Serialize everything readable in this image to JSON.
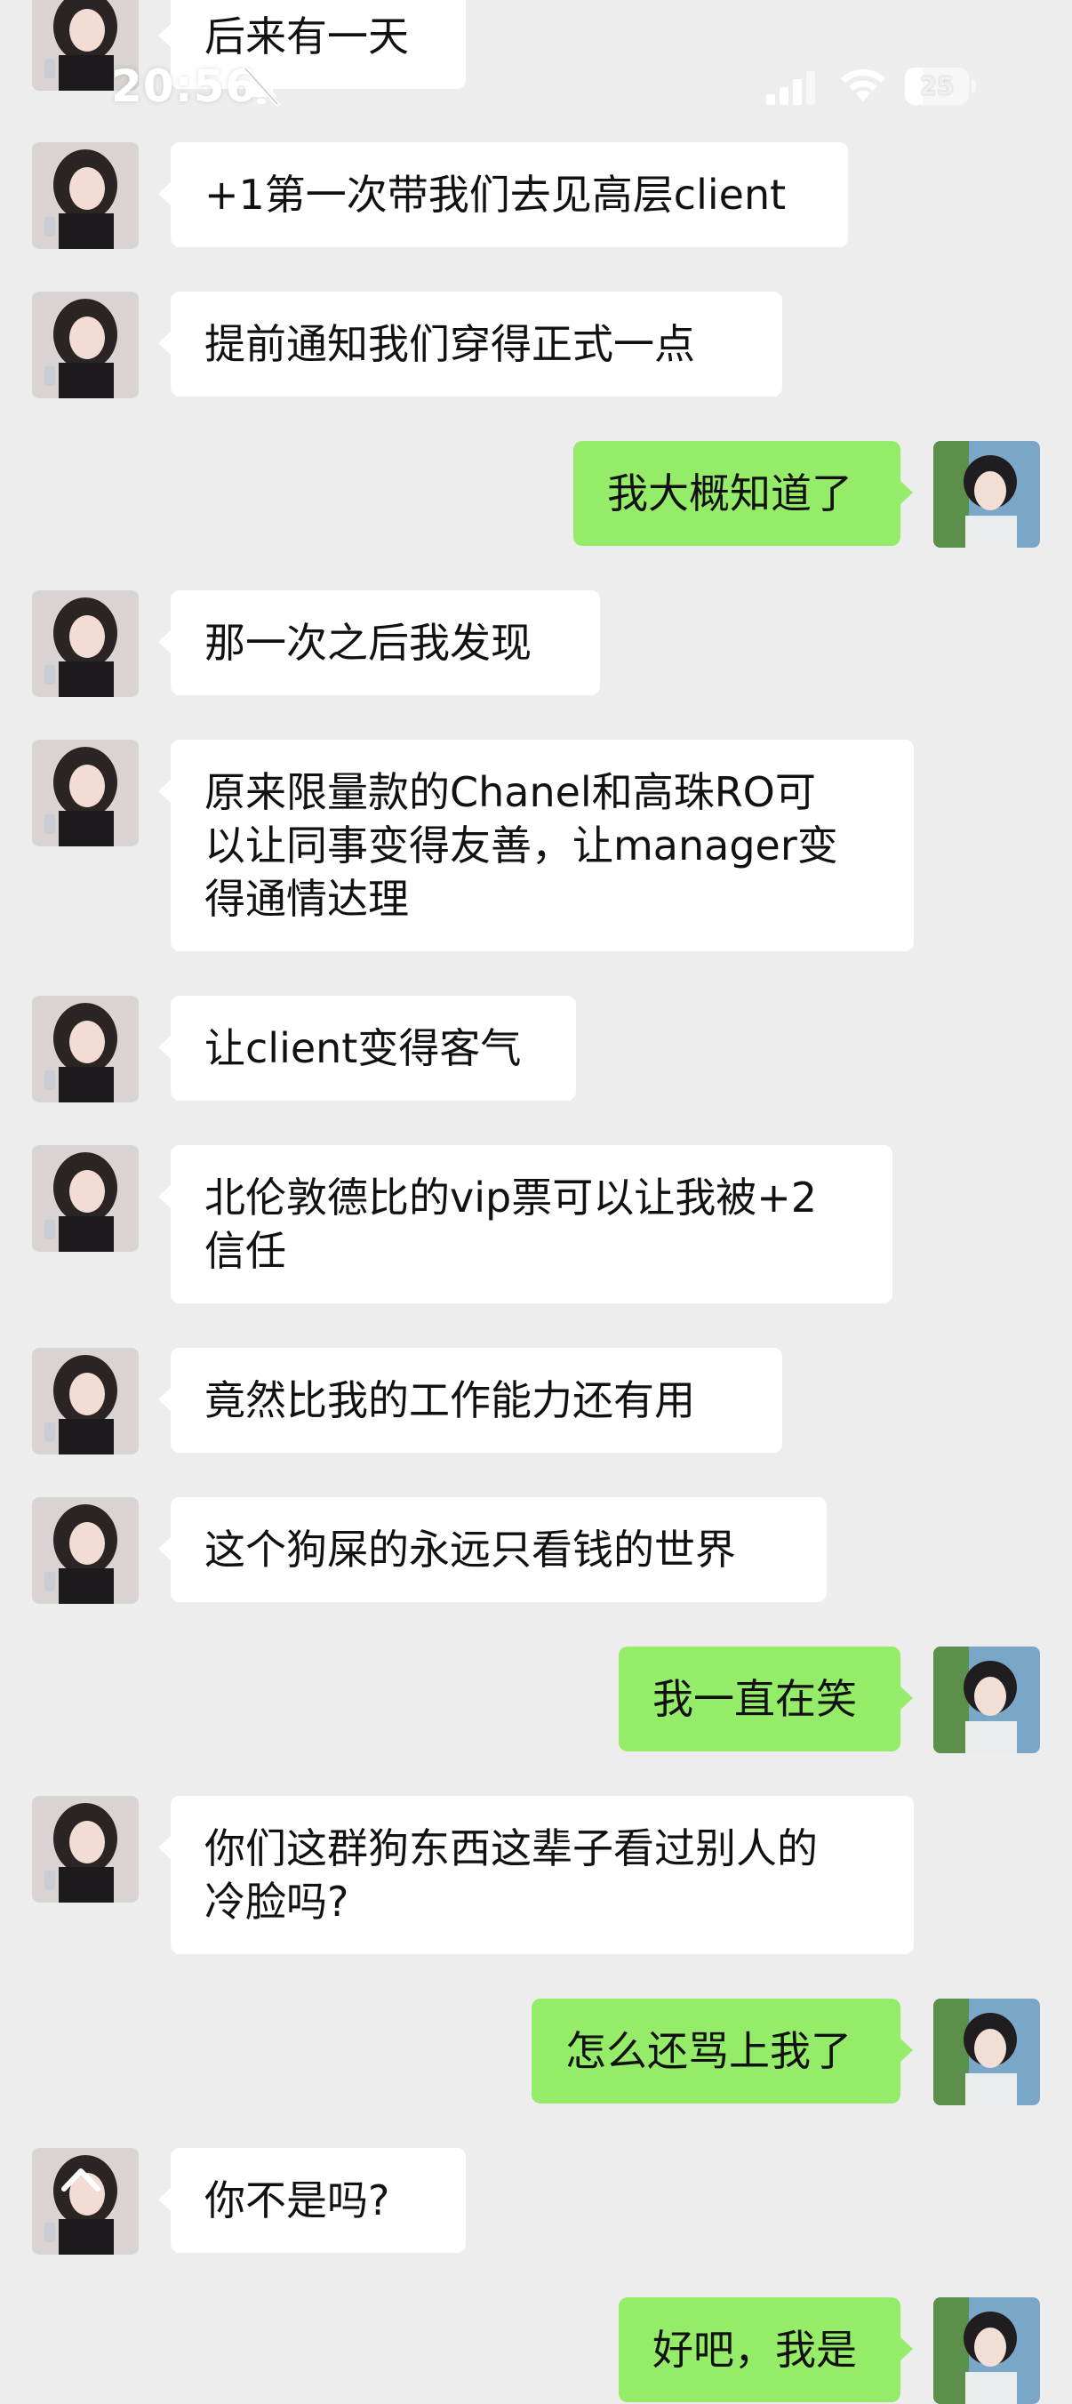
{
  "status_bar": {
    "time": "20:56",
    "battery_level": "25",
    "icons": [
      "mute-bell-icon",
      "signal-icon",
      "wifi-icon",
      "battery-icon"
    ]
  },
  "colors": {
    "background": "#ededed",
    "incoming_bubble": "#ffffff",
    "outgoing_bubble": "#95ec69",
    "text": "#111111"
  },
  "messages": [
    {
      "side": "left",
      "lines": [
        "后来有一天"
      ]
    },
    {
      "side": "left",
      "lines": [
        "+1第一次带我们去见高层client"
      ]
    },
    {
      "side": "left",
      "lines": [
        "提前通知我们穿得正式一点"
      ]
    },
    {
      "side": "right",
      "lines": [
        "我大概知道了"
      ]
    },
    {
      "side": "left",
      "lines": [
        "那一次之后我发现"
      ]
    },
    {
      "side": "left",
      "lines": [
        "原来限量款的Chanel和高珠RO可",
        "以让同事变得友善，让manager变",
        "得通情达理"
      ]
    },
    {
      "side": "left",
      "lines": [
        "让client变得客气"
      ]
    },
    {
      "side": "left",
      "lines": [
        "北伦敦德比的vip票可以让我被+2",
        "信任"
      ]
    },
    {
      "side": "left",
      "lines": [
        "竟然比我的工作能力还有用"
      ]
    },
    {
      "side": "left",
      "lines": [
        "这个狗屎的永远只看钱的世界"
      ]
    },
    {
      "side": "right",
      "lines": [
        "我一直在笑"
      ]
    },
    {
      "side": "left",
      "lines": [
        "你们这群狗东西这辈子看过别人的",
        "冷脸吗?"
      ]
    },
    {
      "side": "right",
      "lines": [
        "怎么还骂上我了"
      ]
    },
    {
      "side": "left",
      "lines": [
        "你不是吗?"
      ]
    },
    {
      "side": "right",
      "lines": [
        "好吧，我是"
      ]
    }
  ]
}
